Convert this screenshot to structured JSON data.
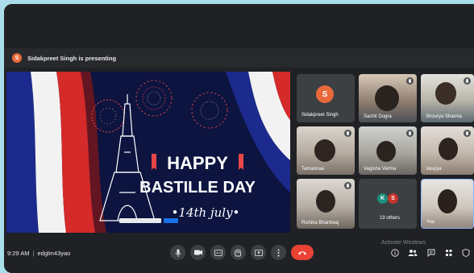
{
  "presenting": {
    "avatar_letter": "S",
    "text": "Sidakpreet Singh is presenting"
  },
  "slide": {
    "line1": "HAPPY",
    "line2": "BASTILLE DAY",
    "line3": "•14th july•",
    "colors": {
      "background": "#0d1440",
      "flag_blue": "#1b2a8c",
      "flag_white": "#f2f2f2",
      "flag_red": "#d42a2a",
      "accent_red": "#e84747"
    }
  },
  "participants": [
    {
      "name": "Sidakpreet Singh",
      "avatar_letter": "S",
      "avatar_color": "#e8693c"
    },
    {
      "name": "Sachit Dogra"
    },
    {
      "name": "Shourya Sharma"
    },
    {
      "name": "Tamannaa"
    },
    {
      "name": "Vagisha Verma"
    },
    {
      "name": "Vaspya"
    },
    {
      "name": "Rishika Bhardwaj"
    },
    {
      "name": "19 others",
      "avatar_letters": [
        "K",
        "S"
      ]
    },
    {
      "name": "You"
    }
  ],
  "bottom": {
    "time": "9:29 AM",
    "meeting_code": "edglm43yao",
    "activate_text": "Activate Windows"
  },
  "icons": {
    "mic": "mic-icon",
    "camera": "camera-icon",
    "captions": "captions-icon",
    "hand": "raise-hand-icon",
    "present": "present-icon",
    "more": "more-options-icon",
    "end": "end-call-icon",
    "info": "info-icon",
    "people": "people-icon",
    "chat": "chat-icon",
    "activities": "activities-icon"
  }
}
